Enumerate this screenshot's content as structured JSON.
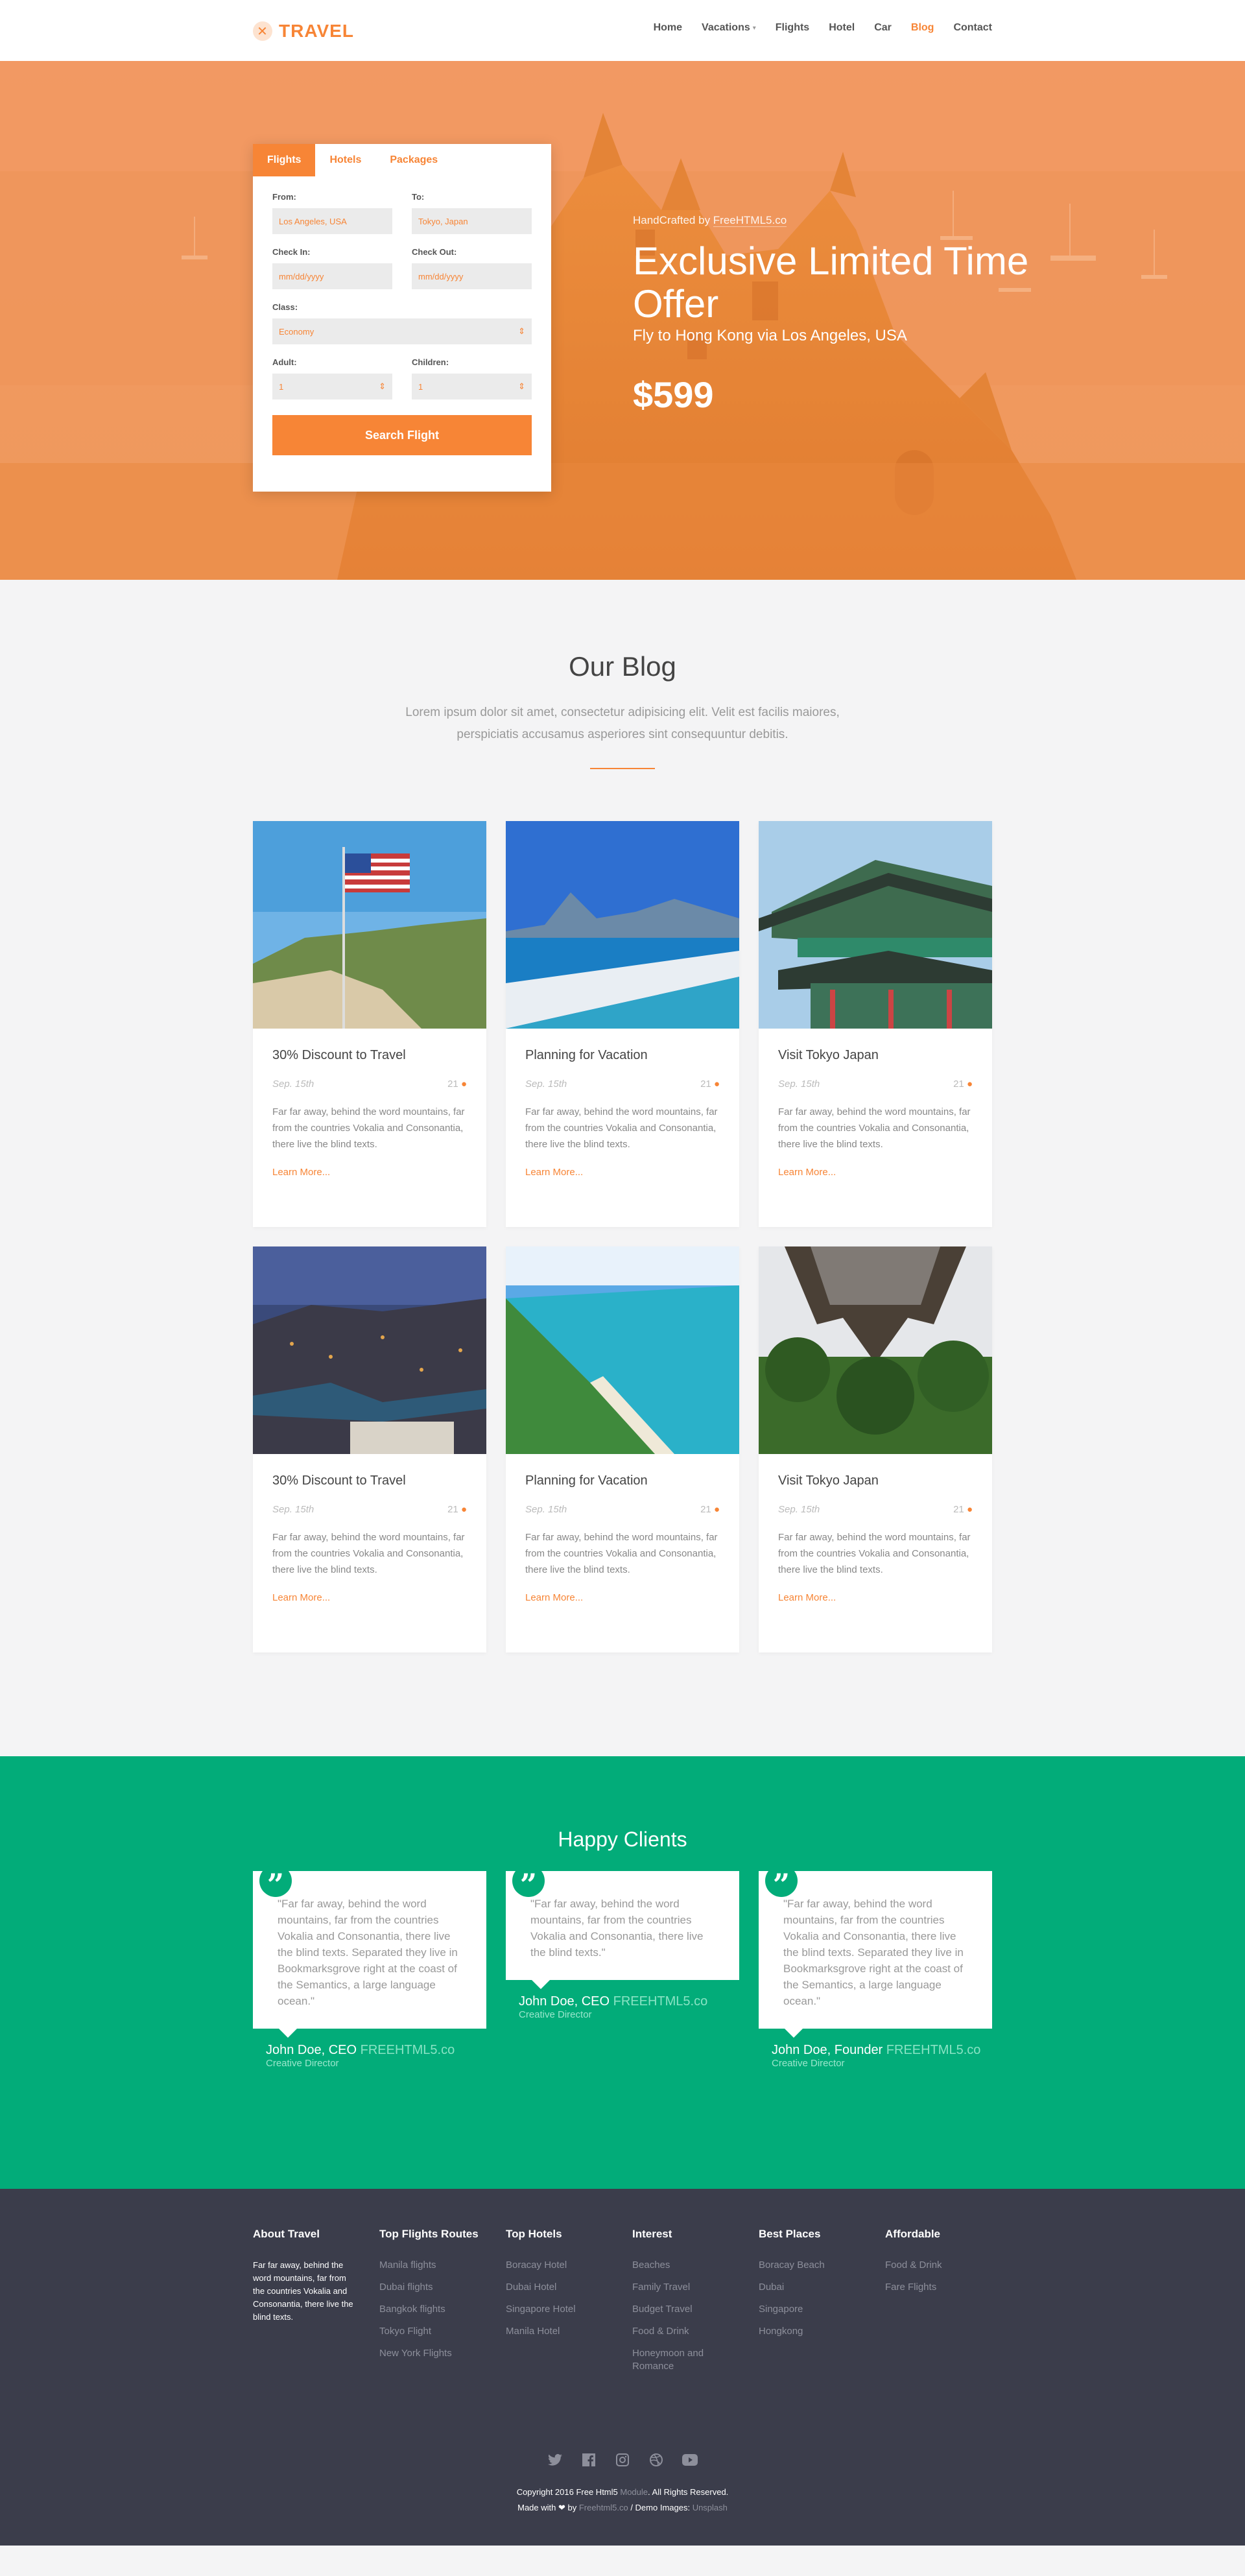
{
  "header": {
    "logo_mark": "✕",
    "logo_text": "TRAVEL",
    "nav": [
      "Home",
      "Vacations",
      "Flights",
      "Hotel",
      "Car",
      "Blog",
      "Contact"
    ],
    "active": "Blog"
  },
  "hero": {
    "tabs": [
      "Flights",
      "Hotels",
      "Packages"
    ],
    "from_label": "From:",
    "from_value": "Los Angeles, USA",
    "to_label": "To:",
    "to_value": "Tokyo, Japan",
    "checkin_label": "Check In:",
    "checkin_placeholder": "mm/dd/yyyy",
    "checkout_label": "Check Out:",
    "checkout_placeholder": "mm/dd/yyyy",
    "class_label": "Class:",
    "class_value": "Economy",
    "adult_label": "Adult:",
    "adult_value": "1",
    "children_label": "Children:",
    "children_value": "1",
    "search_button": "Search Flight",
    "credit_prefix": "HandCrafted by ",
    "credit_link": "FreeHTML5.co",
    "title": "Exclusive Limited Time Offer",
    "route": "Fly to Hong Kong via Los Angeles, USA",
    "price": "$599"
  },
  "blog": {
    "title": "Our Blog",
    "subtitle": "Lorem ipsum dolor sit amet, consectetur adipisicing elit. Velit est facilis maiores, perspiciatis accusamus asperiores sint consequuntur debitis.",
    "posts": [
      {
        "title": "30% Discount to Travel",
        "date": "Sep. 15th",
        "comments": "21",
        "text": "Far far away, behind the word mountains, far from the countries Vokalia and Consonantia, there live the blind texts.",
        "more": "Learn More..."
      },
      {
        "title": "Planning for Vacation",
        "date": "Sep. 15th",
        "comments": "21",
        "text": "Far far away, behind the word mountains, far from the countries Vokalia and Consonantia, there live the blind texts.",
        "more": "Learn More..."
      },
      {
        "title": "Visit Tokyo Japan",
        "date": "Sep. 15th",
        "comments": "21",
        "text": "Far far away, behind the word mountains, far from the countries Vokalia and Consonantia, there live the blind texts.",
        "more": "Learn More..."
      },
      {
        "title": "30% Discount to Travel",
        "date": "Sep. 15th",
        "comments": "21",
        "text": "Far far away, behind the word mountains, far from the countries Vokalia and Consonantia, there live the blind texts.",
        "more": "Learn More..."
      },
      {
        "title": "Planning for Vacation",
        "date": "Sep. 15th",
        "comments": "21",
        "text": "Far far away, behind the word mountains, far from the countries Vokalia and Consonantia, there live the blind texts.",
        "more": "Learn More..."
      },
      {
        "title": "Visit Tokyo Japan",
        "date": "Sep. 15th",
        "comments": "21",
        "text": "Far far away, behind the word mountains, far from the countries Vokalia and Consonantia, there live the blind texts.",
        "more": "Learn More..."
      }
    ]
  },
  "clients": {
    "title": "Happy Clients",
    "items": [
      {
        "quote": "\"Far far away, behind the word mountains, far from the countries Vokalia and Consonantia, there live the blind texts. Separated they live in Bookmarksgrove right at the coast of the Semantics, a large language ocean.\"",
        "name": "John Doe, CEO ",
        "site": "FREEHTML5.co",
        "role": "Creative Director"
      },
      {
        "quote": "\"Far far away, behind the word mountains, far from the countries Vokalia and Consonantia, there live the blind texts.\"",
        "name": "John Doe, CEO ",
        "site": "FREEHTML5.co",
        "role": "Creative Director"
      },
      {
        "quote": "\"Far far away, behind the word mountains, far from the countries Vokalia and Consonantia, there live the blind texts. Separated they live in Bookmarksgrove right at the coast of the Semantics, a large language ocean.\"",
        "name": "John Doe, Founder ",
        "site": "FREEHTML5.co",
        "role": "Creative Director"
      }
    ]
  },
  "footer": {
    "about_title": "About Travel",
    "about_text": "Far far away, behind the word mountains, far from the countries Vokalia and Consonantia, there live the blind texts.",
    "columns": [
      {
        "title": "Top Flights Routes",
        "items": [
          "Manila flights",
          "Dubai flights",
          "Bangkok flights",
          "Tokyo Flight",
          "New York Flights"
        ]
      },
      {
        "title": "Top Hotels",
        "items": [
          "Boracay Hotel",
          "Dubai Hotel",
          "Singapore Hotel",
          "Manila Hotel"
        ]
      },
      {
        "title": "Interest",
        "items": [
          "Beaches",
          "Family Travel",
          "Budget Travel",
          "Food & Drink",
          "Honeymoon and Romance"
        ]
      },
      {
        "title": "Best Places",
        "items": [
          "Boracay Beach",
          "Dubai",
          "Singapore",
          "Hongkong"
        ]
      },
      {
        "title": "Affordable",
        "items": [
          "Food & Drink",
          "Fare Flights"
        ]
      }
    ],
    "social": [
      "twitter-icon",
      "facebook-icon",
      "instagram-icon",
      "dribbble-icon",
      "youtube-icon"
    ],
    "copyright_1a": "Copyright 2016 Free Html5 ",
    "copyright_1b": "Module",
    "copyright_1c": ". All Rights Reserved.",
    "copyright_2a": "Made with ❤ by ",
    "copyright_2b": "Freehtml5.co",
    "copyright_2c": " / Demo Images: ",
    "copyright_2d": "Unsplash"
  },
  "colors": {
    "accent": "#f78536",
    "green": "#02ac79",
    "footer": "#3b3d4b"
  }
}
